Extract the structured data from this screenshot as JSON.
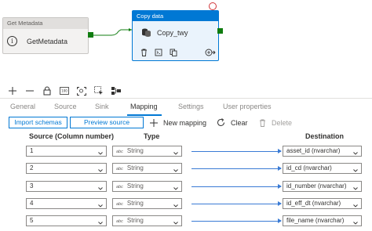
{
  "canvas": {
    "get_metadata": {
      "header": "Get Metadata",
      "name": "GetMetadata",
      "icon": "info-icon"
    },
    "copy_data": {
      "header": "Copy data",
      "name": "Copy_twy",
      "tools": [
        "delete-icon",
        "code-icon",
        "copy-icon",
        "go-to-icon"
      ]
    }
  },
  "toolbar": [
    "add-icon",
    "minus-icon",
    "lock-icon",
    "zoom-100-icon",
    "zoom-fit-icon",
    "select-icon",
    "auto-align-icon"
  ],
  "tabs": {
    "labels": [
      "General",
      "Source",
      "Sink",
      "Mapping",
      "Settings",
      "User properties"
    ],
    "active": "Mapping"
  },
  "actions": {
    "import_schemas": "Import schemas",
    "preview_source": "Preview source",
    "new_mapping": "New mapping",
    "clear": "Clear",
    "delete": "Delete"
  },
  "mapping": {
    "headers": {
      "source": "Source (Column number)",
      "type": "Type",
      "destination": "Destination"
    },
    "rows": [
      {
        "source": "1",
        "type_icon": "abc",
        "type": "String",
        "destination": "asset_id (nvarchar)"
      },
      {
        "source": "2",
        "type_icon": "abc",
        "type": "String",
        "destination": "id_cd (nvarchar)"
      },
      {
        "source": "3",
        "type_icon": "abc",
        "type": "String",
        "destination": "id_number (nvarchar)"
      },
      {
        "source": "4",
        "type_icon": "abc",
        "type": "String",
        "destination": "id_eff_dt (nvarchar)"
      },
      {
        "source": "5",
        "type_icon": "abc",
        "type": "String",
        "destination": "file_name (nvarchar)"
      }
    ]
  },
  "colors": {
    "accent": "#0078d4",
    "success": "#107c10",
    "error": "#d13438",
    "map_line": "#3a7bd5"
  }
}
